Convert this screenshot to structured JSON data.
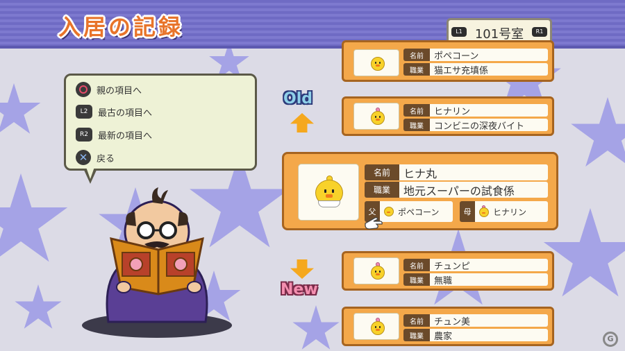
{
  "header": {
    "title": "入居の記録",
    "room": "101号室",
    "l1": "L1",
    "r1": "R1"
  },
  "help": {
    "items": [
      {
        "button": "○",
        "label": "親の項目へ"
      },
      {
        "button": "L2",
        "label": "最古の項目へ"
      },
      {
        "button": "R2",
        "label": "最新の項目へ"
      },
      {
        "button": "×",
        "label": "戻る"
      }
    ]
  },
  "nav": {
    "old": "Old",
    "new": "New"
  },
  "records": [
    {
      "name_key": "名前",
      "name": "ポペコーン",
      "job_key": "職業",
      "job": "猫エサ充填係"
    },
    {
      "name_key": "名前",
      "name": "ヒナリン",
      "job_key": "職業",
      "job": "コンビニの深夜バイト"
    },
    {
      "name_key": "名前",
      "name": "チュンピ",
      "job_key": "職業",
      "job": "無職"
    },
    {
      "name_key": "名前",
      "name": "チュン美",
      "job_key": "職業",
      "job": "農家"
    }
  ],
  "selected": {
    "name_key": "名前",
    "name": "ヒナ丸",
    "job_key": "職業",
    "job": "地元スーパーの試食係",
    "father_key": "父",
    "father": "ポペコーン",
    "mother_key": "母",
    "mother": "ヒナリン"
  },
  "colors": {
    "header": "#6f6bc4",
    "title": "#e8742a",
    "card": "#f4a84a",
    "card_border": "#a66420",
    "star": "#a5a3e6",
    "background": "#dcdbe6"
  }
}
